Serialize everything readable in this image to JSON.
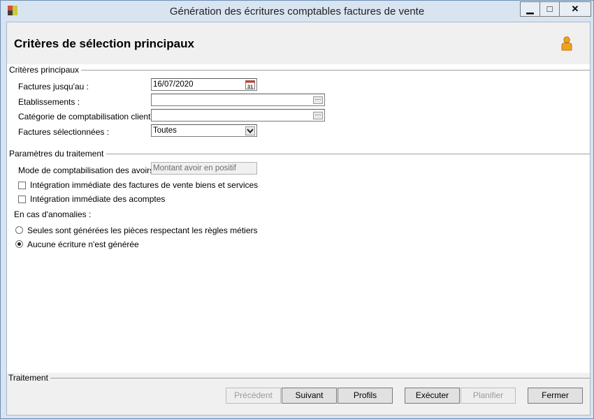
{
  "window": {
    "title": "Génération des écritures comptables factures de vente",
    "controls": {
      "minimize": "▁",
      "maximize": "□",
      "close": "✕"
    }
  },
  "header": {
    "title": "Critères de sélection principaux",
    "icon": "person-icon"
  },
  "criteria": {
    "group_label": "Critères principaux",
    "invoices_until": {
      "label": "Factures jusqu'au :",
      "value": "16/07/2020"
    },
    "establishments": {
      "label": "Etablissements :",
      "value": ""
    },
    "client_category": {
      "label": "Catégorie de comptabilisation client :",
      "value": ""
    },
    "selected_invoices": {
      "label": "Factures sélectionnées :",
      "value": "Toutes"
    }
  },
  "processing": {
    "group_label": "Paramètres du traitement",
    "credit_mode": {
      "label": "Mode de comptabilisation des avoirs :",
      "value": "Montant avoir en positif"
    },
    "integrate_invoices": {
      "label": "Intégration immédiate des factures de vente biens et services",
      "checked": false
    },
    "integrate_deposits": {
      "label": "Intégration immédiate des acomptes",
      "checked": false
    },
    "anomalies_label": "En cas d'anomalies :",
    "radio_rules": {
      "label": "Seules sont générées les pièces respectant les règles métiers",
      "selected": false
    },
    "radio_none": {
      "label": "Aucune écriture n'est générée",
      "selected": true
    }
  },
  "footer": {
    "group_label": "Traitement",
    "buttons": {
      "previous": "Précédent",
      "next": "Suivant",
      "profiles": "Profils",
      "execute": "Exécuter",
      "schedule": "Planifier",
      "close": "Fermer"
    }
  },
  "colors": {
    "window_frame": "#d9e4f1",
    "header_bg": "#f0f0f0",
    "icon_orange": "#f0a020"
  }
}
